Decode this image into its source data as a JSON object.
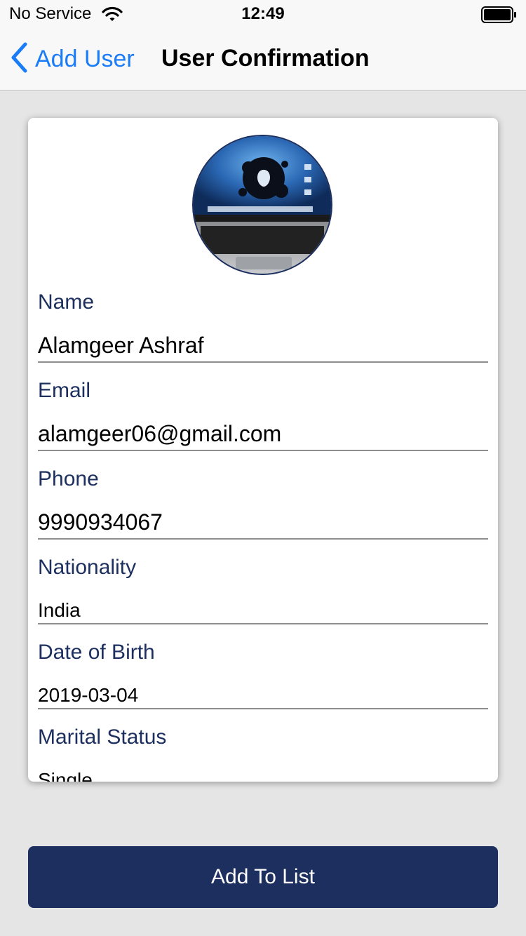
{
  "status_bar": {
    "carrier": "No Service",
    "time": "12:49"
  },
  "nav": {
    "back_label": "Add User",
    "title": "User Confirmation"
  },
  "card": {
    "fields": [
      {
        "label": "Name",
        "value": "Alamgeer Ashraf"
      },
      {
        "label": "Email",
        "value": "alamgeer06@gmail.com"
      },
      {
        "label": "Phone",
        "value": "9990934067"
      },
      {
        "label": "Nationality",
        "value": "India"
      },
      {
        "label": "Date of Birth",
        "value": "2019-03-04"
      },
      {
        "label": "Marital Status",
        "value": "Single"
      }
    ]
  },
  "actions": {
    "add_to_list_label": "Add To List"
  },
  "colors": {
    "accent": "#1a7cf6",
    "brand_navy": "#1c2f5e",
    "background": "#e5e5e5"
  }
}
